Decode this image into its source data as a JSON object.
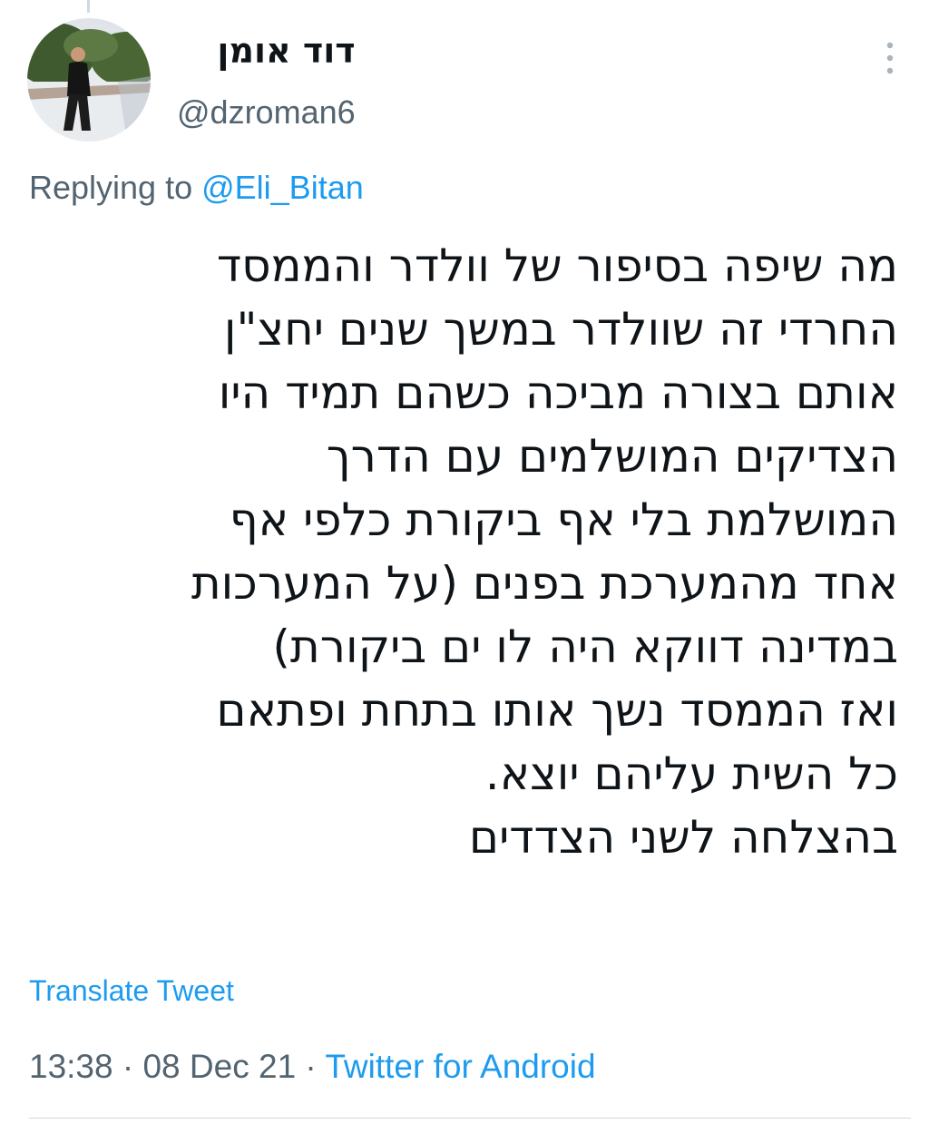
{
  "tweet": {
    "author": {
      "display_name": "דוד אומן",
      "handle": "@dzroman6"
    },
    "more_icon": "vertical-ellipsis-icon",
    "reply": {
      "prefix": "Replying to ",
      "mention": "@Eli_Bitan"
    },
    "body_lines": [
      "מה שיפה בסיפור של וולדר והממסד",
      "החרדי זה שוולדר במשך שנים יחצ\"ן",
      "אותם בצורה מביכה כשהם תמיד היו",
      "הצדיקים המושלמים עם הדרך",
      "המושלמת בלי אף ביקורת כלפי אף",
      "אחד מהמערכת בפנים (על המערכות",
      "במדינה דווקא היה לו ים ביקורת)",
      "ואז הממסד נשך אותו בתחת ופתאם",
      "כל השית עליהם יוצא.",
      "בהצלחה לשני הצדדים"
    ],
    "translate_label": "Translate Tweet",
    "time": "13:38",
    "separator": " · ",
    "date": "08 Dec 21",
    "source": "Twitter for Android",
    "colors": {
      "accent": "#1d9bf0",
      "secondary_text": "#536471",
      "primary_text": "#0f1419",
      "divider": "#cfd9de"
    }
  }
}
